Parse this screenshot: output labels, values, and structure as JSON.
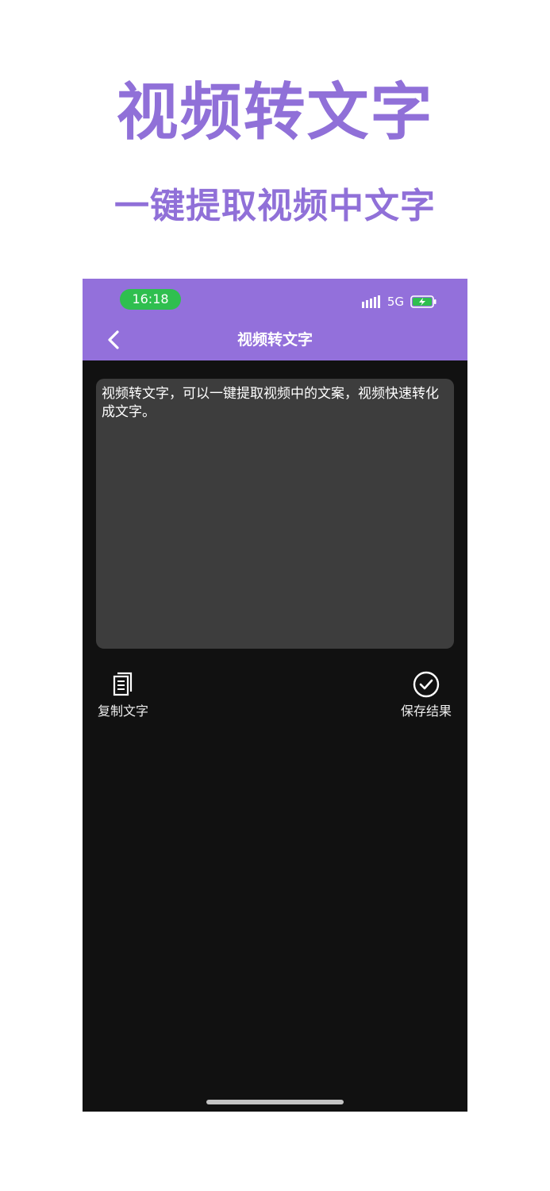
{
  "promo": {
    "title": "视频转文字",
    "subtitle": "一键提取视频中文字"
  },
  "status_bar": {
    "time": "16:18",
    "network": "5G",
    "icons": [
      "signal-icon",
      "battery-charging-icon"
    ]
  },
  "nav": {
    "title": "视频转文字",
    "back_icon": "chevron-left-icon"
  },
  "content": {
    "text": "视频转文字，可以一键提取视频中的文案，视频快速转化成文字。"
  },
  "actions": {
    "copy": {
      "label": "复制文字",
      "icon": "copy-document-icon"
    },
    "save": {
      "label": "保存结果",
      "icon": "check-circle-icon"
    }
  },
  "colors": {
    "brand_purple": "#9370db",
    "promo_text": "#9070d8",
    "screen_background": "#111111",
    "text_box_background": "#3d3d3d",
    "status_pill_green": "#2fbf4f"
  }
}
